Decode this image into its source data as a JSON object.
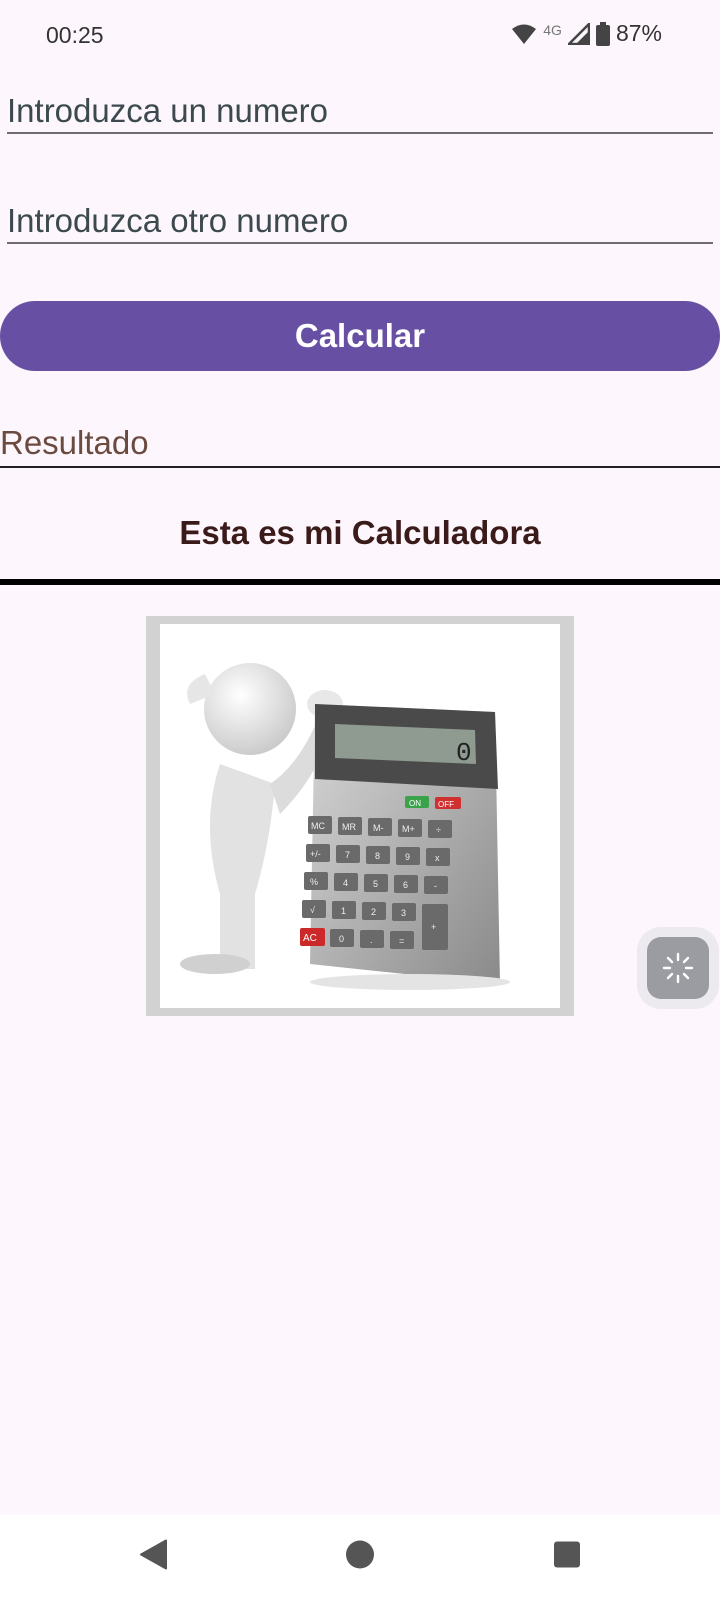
{
  "status": {
    "time": "00:25",
    "network": "4G",
    "battery": "87%"
  },
  "form": {
    "first_placeholder": "Introduzca un numero",
    "second_placeholder": "Introduzca otro numero",
    "calculate_label": "Calcular",
    "result_label": "Resultado"
  },
  "heading": "Esta es mi Calculadora",
  "calculator_image": {
    "display": "0",
    "keys_row1": [
      "MC",
      "MR",
      "M-",
      "M+",
      "÷"
    ],
    "keys_row2": [
      "+/-",
      "7",
      "8",
      "9",
      "x"
    ],
    "keys_row3": [
      "%",
      "4",
      "5",
      "6",
      "-"
    ],
    "keys_row4": [
      "√",
      "1",
      "2",
      "3"
    ],
    "keys_row5": [
      "AC",
      "0",
      ".",
      "=",
      "+"
    ],
    "on_label": "ON",
    "off_label": "OFF"
  },
  "colors": {
    "accent": "#6750a4",
    "background": "#fdf7fd",
    "heading": "#3b1a1a"
  }
}
